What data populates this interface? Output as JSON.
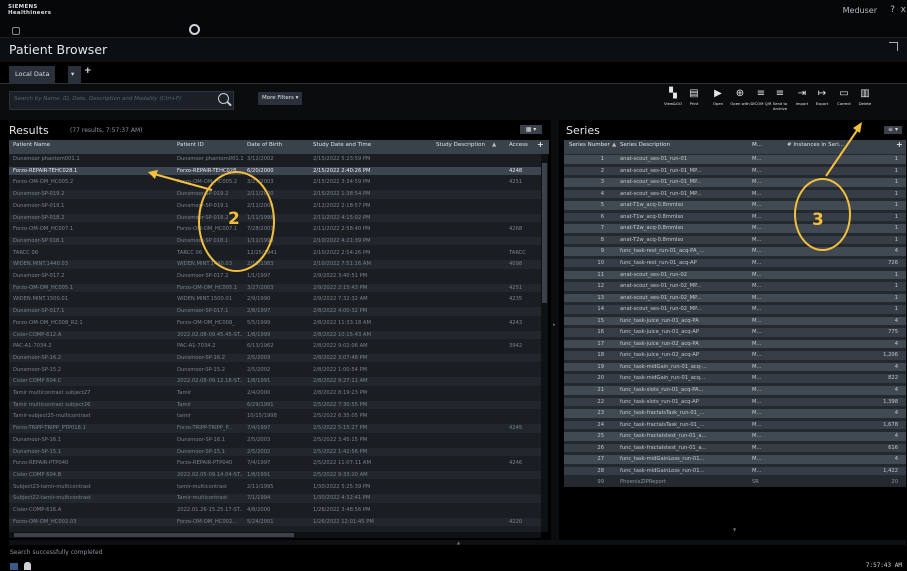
{
  "app": {
    "logo_line1": "SIEMENS",
    "logo_line2": "Healthineers",
    "user": "Meduser",
    "help": "?",
    "close": "x",
    "title": "Patient Browser"
  },
  "tabs": {
    "local_data": "Local Data",
    "dropdown": "▾",
    "add": "+"
  },
  "search": {
    "placeholder": "Search by Name, ID, Date, Description and Modality (Ctrl+F)",
    "more_filters": "More Filters ▾"
  },
  "toolbar": [
    {
      "label": "View&GO",
      "icon": "viewgo-icon",
      "glyph": "▚"
    },
    {
      "label": "Print",
      "icon": "print-icon",
      "glyph": "▤"
    },
    {
      "label": "Open",
      "icon": "open-icon",
      "glyph": "▶"
    },
    {
      "label": "Open with",
      "icon": "open-with-icon",
      "glyph": "⊕"
    },
    {
      "label": "DICOM Q/R",
      "icon": "dicom-qr-icon",
      "glyph": "≡"
    },
    {
      "label": "Send to Archive",
      "icon": "send-archive-icon",
      "glyph": "≡"
    },
    {
      "label": "Import",
      "icon": "import-icon",
      "glyph": "⇥"
    },
    {
      "label": "Export",
      "icon": "export-icon",
      "glyph": "↦"
    },
    {
      "label": "Correct",
      "icon": "correct-icon",
      "glyph": "▭"
    },
    {
      "label": "Delete",
      "icon": "delete-icon",
      "glyph": "▥"
    }
  ],
  "results": {
    "title": "Results",
    "count": "(77 results, 7:57:37 AM)",
    "view_icon": "▦ ▾",
    "columns": [
      "Patient Name",
      "Patient ID",
      "Date of Birth",
      "Study Date and Time",
      "Study Description",
      "Access"
    ],
    "rows": [
      [
        "Dunsmoor phantom001.1",
        "Dunsmoor phantom001.1",
        "3/12/2002",
        "2/15/2022 5:23:59 PM",
        "",
        ""
      ],
      [
        "Forzo-REPAIR-TEHC028.1",
        "Forzo-REPAIR-TEHC028",
        "6/20/2000",
        "2/15/2022 2:40:26 PM",
        "",
        "4248"
      ],
      [
        "Forzo-OM-OM_HC005.2",
        "Forzo-OM-OM_HC005.2",
        "3/27/2003",
        "2/15/2022 3:34:59 PM",
        "",
        "4251"
      ],
      [
        "Dunsmoor-SP-019.2",
        "Dunsmoor-SP-019.2",
        "2/11/2000",
        "2/15/2022 1:38:54 PM",
        "",
        ""
      ],
      [
        "Dunsmoor-SP-019.1",
        "Dunsmoor-SP-019.1",
        "2/11/2000",
        "2/12/2022 2:18:57 PM",
        "",
        ""
      ],
      [
        "Dunsmoor-SP-018.2",
        "Dunsmoor-SP-018.2",
        "1/11/1998",
        "2/11/2022 4:15:02 PM",
        "",
        ""
      ],
      [
        "Forzo-OM-OM_HC007.1",
        "Forzo-OM-OM_HC007.1",
        "7/28/2003",
        "2/11/2022 2:58:40 PM",
        "",
        "4268"
      ],
      [
        "Dunsmoor-SP 018.1",
        "Dunsmoor-SP 018.1",
        "1/11/1998",
        "2/10/2022 4:21:39 PM",
        "",
        ""
      ],
      [
        "TARCC 06",
        "TARCC 06",
        "12/25/1941",
        "2/10/2022 2:54:26 PM",
        "",
        "TARCC"
      ],
      [
        "WIDEN.MINT.1440.03",
        "WIDEN.MINT.1440.03",
        "2/10/1983",
        "2/10/2022 7:51:16 AM",
        "",
        "4098"
      ],
      [
        "Dunsmoor-SP-017.2",
        "Dunsmoor-SP-017.2",
        "1/1/1997",
        "2/9/2022 3:40:51 PM",
        "",
        ""
      ],
      [
        "Forzo-OM-OM_HC005.1",
        "Forzo-OM-OM_HC005.1",
        "3/27/2003",
        "2/9/2022 2:15:43 PM",
        "",
        "4251"
      ],
      [
        "WIDEN.MINT.1500.01",
        "WIDEN.MINT.1500.01",
        "2/9/1990",
        "2/9/2022 7:32:32 AM",
        "",
        "4235"
      ],
      [
        "Dunsmoor-SP-017.1",
        "Dunsmoor-SP-017.1",
        "2/8/1997",
        "2/8/2022 4:00:32 PM",
        "",
        ""
      ],
      [
        "Forzo-OM-OM_HC008_R2.1",
        "Forzo-OM-OM_HC008_",
        "5/5/1999",
        "2/8/2022 11:33:18 AM",
        "",
        "4243"
      ],
      [
        "Cisler-COMP-612.A",
        "2022.02.08-09.45.45-ST...",
        "1/8/1999",
        "2/8/2022 10:15:43 AM",
        "",
        ""
      ],
      [
        "PAC-A1-7034.2",
        "PAC-A1-7034.2",
        "6/13/1962",
        "2/8/2022 9:02:06 AM",
        "",
        "3942"
      ],
      [
        "Dunsmoor-SP-16.2",
        "Dunsmoor-SP-16.2",
        "2/5/2003",
        "2/8/2022 3:07:48 PM",
        "",
        ""
      ],
      [
        "Dunsmoor-SP-15.2",
        "Dunsmoor-SP-15.2",
        "2/5/2002",
        "2/8/2022 1:00:54 PM",
        "",
        ""
      ],
      [
        "Cisler COMP 604.C",
        "2022.02.08-09.12.18-ST...",
        "1/8/1991",
        "2/8/2022 9:27:11 AM",
        "",
        ""
      ],
      [
        "Tamir multicontrast subject27",
        "Tamir",
        "2/4/2000",
        "2/8/2022 8:19:23 PM",
        "",
        ""
      ],
      [
        "Tamir multicontrast subject26",
        "Tamir",
        "6/29/1991",
        "2/5/2022 7:30:55 PM",
        "",
        ""
      ],
      [
        "Tamir-subject25-multicontrast",
        "tamir",
        "10/15/1998",
        "2/5/2022 6:35:05 PM",
        "",
        ""
      ],
      [
        "Forzo-TRIPP-TRIPP_PTP018.1",
        "Forzo-TRIPP-TRIPP_P...",
        "7/4/1997",
        "2/5/2022 5:15:27 PM",
        "",
        "4245"
      ],
      [
        "Dunsmoor-SP-16.1",
        "Dunsmoor-SP-16.1",
        "2/5/2003",
        "2/5/2022 3:45:15 PM",
        "",
        ""
      ],
      [
        "Dunsmoor-SP-15.1",
        "Dunsmoor-SP-15.1",
        "2/5/2002",
        "2/5/2022 1:42:56 PM",
        "",
        ""
      ],
      [
        "Forzo-REPAIR-PTP040",
        "Forzo-REPAIR-PTP040",
        "7/4/1997",
        "2/5/2022 11:07:11 AM",
        "",
        "4246"
      ],
      [
        "Cisler COMP 604.B",
        "2022.02.05-09.14.04-ST...",
        "1/8/1991",
        "2/5/2022 9:33:20 AM",
        "",
        ""
      ],
      [
        "Subject23-tamir-multicontrast",
        "tamir-multicontrast",
        "2/11/1995",
        "1/30/2022 5:25:39 PM",
        "",
        ""
      ],
      [
        "Subject22-tamir-multicontrast",
        "Tamir-multicontrast",
        "7/1/1994",
        "1/30/2022 4:32:41 PM",
        "",
        ""
      ],
      [
        "Cisler-COMP-616.A",
        "2022.01.26-15.25.17-ST...",
        "4/8/2000",
        "1/26/2022 3:48:56 PM",
        "",
        ""
      ],
      [
        "Forzo-OM-OM_HC002.03",
        "Forzo-OM-OM_HC002...",
        "5/24/2001",
        "1/26/2022 12:01:45 PM",
        "",
        "4220"
      ]
    ]
  },
  "series": {
    "title": "Series",
    "menu_icon": "≡ ▾",
    "add": "+",
    "columns": [
      "Series Number",
      "Series Description",
      "M...",
      "# Instances in Seri..."
    ],
    "rows": [
      [
        "1",
        "anat-scout_ses-01_run-01",
        "M...",
        "1"
      ],
      [
        "2",
        "anat-scout_ses-01_run-01_MP...",
        "M...",
        "1"
      ],
      [
        "3",
        "anat-scout_ses-01_run-01_MP...",
        "M...",
        "1"
      ],
      [
        "4",
        "anat-scout_ses-01_run-01_MP...",
        "M...",
        "1"
      ],
      [
        "5",
        "anat-T1w_acq-0.8mmIso",
        "M...",
        "1"
      ],
      [
        "6",
        "anat-T1w_acq-0.8mmIso",
        "M...",
        "1"
      ],
      [
        "7",
        "anat-T2w_acq-0.8mmIso",
        "M...",
        "1"
      ],
      [
        "8",
        "anat-T2w_acq-0.8mmIso",
        "M...",
        "1"
      ],
      [
        "9",
        "func_task-rest_run-01_acq-PA_...",
        "M...",
        "4"
      ],
      [
        "10",
        "func_task-rest_run-01_acq-AP",
        "M...",
        "726"
      ],
      [
        "11",
        "anat-scout_ses-01_run-02",
        "M...",
        "1"
      ],
      [
        "12",
        "anat-scout_ses-01_run-02_MP...",
        "M...",
        "1"
      ],
      [
        "13",
        "anat-scout_ses-01_run-02_MP...",
        "M...",
        "1"
      ],
      [
        "14",
        "anat-scout_ses-01_run-02_MP...",
        "M...",
        "1"
      ],
      [
        "15",
        "func_task-juice_run-01_acq-PA",
        "M...",
        "4"
      ],
      [
        "16",
        "func_task-juice_run-01_acq-AP",
        "M...",
        "775"
      ],
      [
        "17",
        "func_task-juice_run-02_acq-PA",
        "M...",
        "4"
      ],
      [
        "18",
        "func_task-juice_run-02_acq-AP",
        "M...",
        "1,206"
      ],
      [
        "19",
        "func_task-midGain_run-01_acq-...",
        "M...",
        "4"
      ],
      [
        "20",
        "func_task-midGain_run-01_acq...",
        "M...",
        "822"
      ],
      [
        "21",
        "func_task-slots_run-01_acq-PA...",
        "M...",
        "4"
      ],
      [
        "22",
        "func_task-slots_run-01_acq-AP",
        "M...",
        "1,398"
      ],
      [
        "23",
        "func_task-fractalsTask_run-01_...",
        "M...",
        "4"
      ],
      [
        "24",
        "func_task-fractalsTask_run-01_...",
        "M...",
        "1,678"
      ],
      [
        "25",
        "func_task-fractalstest_run-01_a...",
        "M...",
        "4"
      ],
      [
        "26",
        "func_task-fractalstest_run-01_a...",
        "M...",
        "616"
      ],
      [
        "27",
        "func_task-midGainLoss_run-01...",
        "M...",
        "4"
      ],
      [
        "28",
        "func_task-midGainLoss_run-01...",
        "M...",
        "1,422"
      ],
      [
        "99",
        "PhoenixZIPReport",
        "SR",
        "20"
      ]
    ]
  },
  "annotations": {
    "two": "2",
    "three": "3"
  },
  "status": {
    "message": "Search successfully completed",
    "clock": "7:57:43 AM"
  }
}
